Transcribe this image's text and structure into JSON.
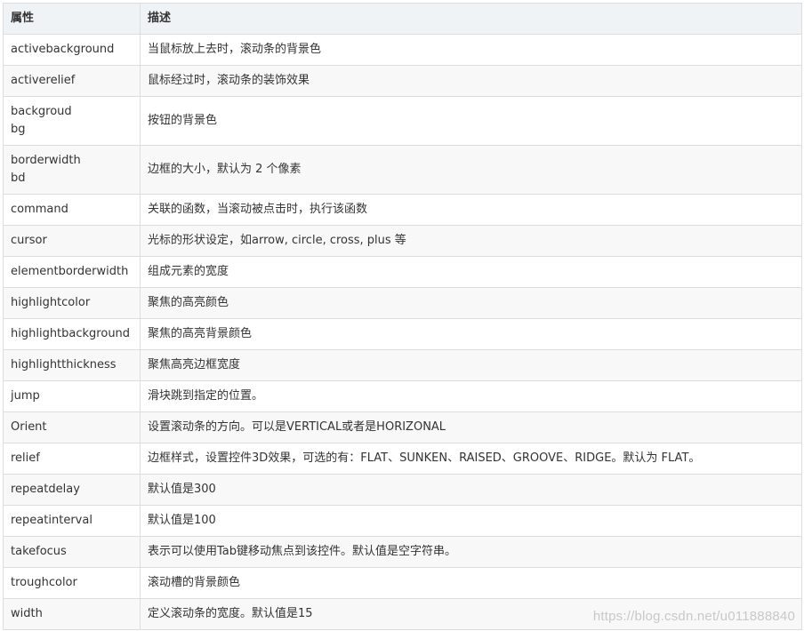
{
  "table": {
    "headers": [
      "属性",
      "描述"
    ],
    "rows": [
      {
        "name": "activebackground",
        "desc": "当鼠标放上去时，滚动条的背景色"
      },
      {
        "name": "activerelief",
        "desc": "鼠标经过时，滚动条的装饰效果"
      },
      {
        "name": "backgroud",
        "alias": "bg",
        "desc": "按钮的背景色"
      },
      {
        "name": "borderwidth",
        "alias": "bd",
        "desc": "边框的大小，默认为 2 个像素"
      },
      {
        "name": "command",
        "desc": "关联的函数，当滚动被点击时，执行该函数"
      },
      {
        "name": "cursor",
        "desc": "光标的形状设定，如arrow, circle, cross, plus 等"
      },
      {
        "name": "elementborderwidth",
        "desc": "组成元素的宽度"
      },
      {
        "name": "highlightcolor",
        "desc": "聚焦的高亮颜色"
      },
      {
        "name": "highlightbackground",
        "desc": "聚焦的高亮背景颜色"
      },
      {
        "name": "highlightthickness",
        "desc": "聚焦高亮边框宽度"
      },
      {
        "name": "jump",
        "desc": "滑块跳到指定的位置。"
      },
      {
        "name": "Orient",
        "desc": "设置滚动条的方向。可以是VERTICAL或者是HORIZONAL"
      },
      {
        "name": "relief",
        "desc": "边框样式，设置控件3D效果，可选的有：FLAT、SUNKEN、RAISED、GROOVE、RIDGE。默认为 FLAT。"
      },
      {
        "name": "repeatdelay",
        "desc": "默认值是300"
      },
      {
        "name": "repeatinterval",
        "desc": "默认值是100"
      },
      {
        "name": "takefocus",
        "desc": "表示可以使用Tab键移动焦点到该控件。默认值是空字符串。"
      },
      {
        "name": "troughcolor",
        "desc": "滚动槽的背景颜色"
      },
      {
        "name": "width",
        "desc": "定义滚动条的宽度。默认值是15"
      }
    ]
  },
  "watermark": "https://blog.csdn.net/u011888840",
  "colors": {
    "header_bg": "#eff3f5",
    "row_alt_bg": "#f8f8f8",
    "border": "#dddddd",
    "text": "#333333"
  }
}
